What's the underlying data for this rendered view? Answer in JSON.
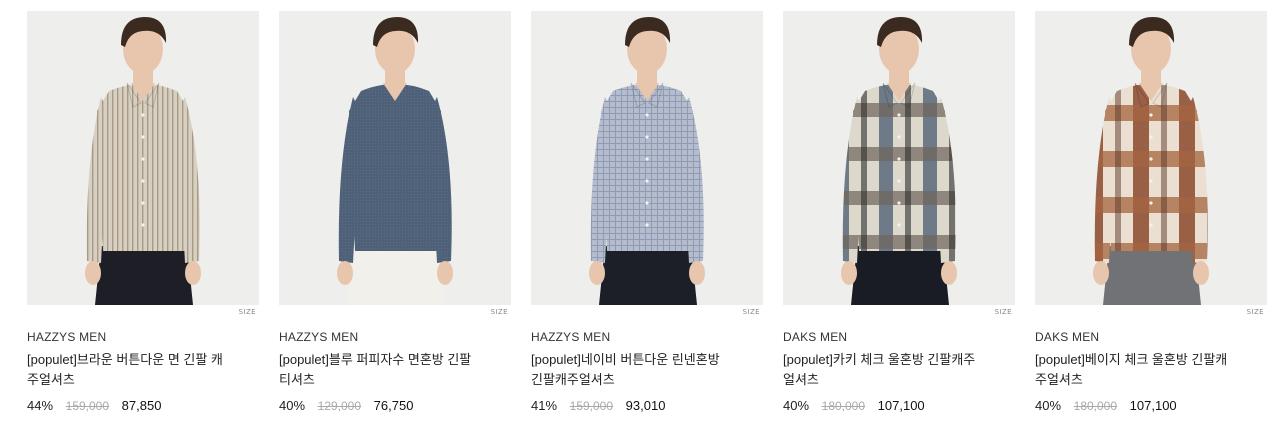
{
  "products": [
    {
      "brand": "HAZZYS MEN",
      "name": "[populet]브라운 버튼다운 면 긴팔 캐주얼셔츠",
      "discount": "44%",
      "original_price": "159,000",
      "price": "87,850",
      "size_label": "SIZE",
      "shirt_color": "#d6cfc2",
      "pants_color": "#1e1f26",
      "shirt_type": "stripe"
    },
    {
      "brand": "HAZZYS MEN",
      "name": "[populet]블루 퍼피자수 면혼방 긴팔티셔츠",
      "discount": "40%",
      "original_price": "129,000",
      "price": "76,750",
      "size_label": "SIZE",
      "shirt_color": "#4f6079",
      "pants_color": "#f2f0ea",
      "shirt_type": "knit"
    },
    {
      "brand": "HAZZYS MEN",
      "name": "[populet]네이비 버튼다운 린넨혼방 긴팔캐주얼셔츠",
      "discount": "41%",
      "original_price": "159,000",
      "price": "93,010",
      "size_label": "SIZE",
      "shirt_color": "#b4bccd",
      "pants_color": "#1c1e28",
      "shirt_type": "check-small"
    },
    {
      "brand": "DAKS MEN",
      "name": "[populet]카키 체크 울혼방 긴팔캐주얼셔츠",
      "discount": "40%",
      "original_price": "180,000",
      "price": "107,100",
      "size_label": "SIZE",
      "shirt_color": "#8c887c",
      "pants_color": "#1a1c25",
      "shirt_type": "check-large-khaki"
    },
    {
      "brand": "DAKS MEN",
      "name": "[populet]베이지 체크 울혼방 긴팔캐주얼셔츠",
      "discount": "40%",
      "original_price": "180,000",
      "price": "107,100",
      "size_label": "SIZE",
      "shirt_color": "#b08a6e",
      "pants_color": "#707276",
      "shirt_type": "check-large-beige"
    }
  ]
}
